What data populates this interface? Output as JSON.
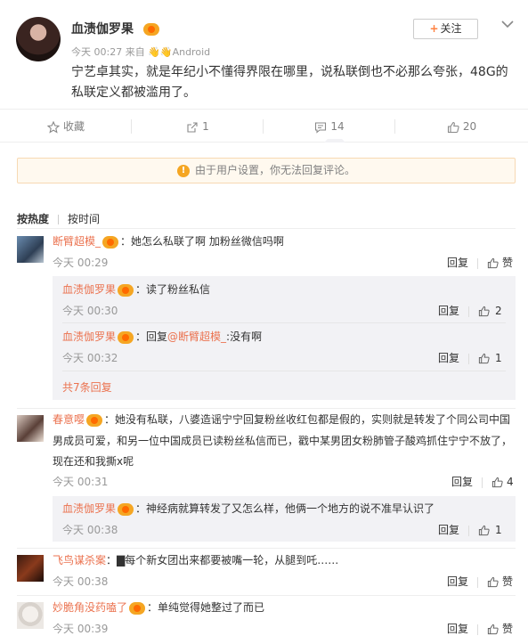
{
  "post": {
    "nickname": "血渍伽罗果",
    "meta": "今天 00:27 来自 👋👋Android",
    "content": "宁艺卓其实，就是年纪小不懂得界限在哪里，说私联倒也不必那么夸张，48G的私联定义都被滥用了。",
    "follow_label": "关注",
    "follow_plus": "+"
  },
  "actions": {
    "favorite_label": "收藏",
    "repost_count": "1",
    "comment_count": "14",
    "like_count": "20"
  },
  "notice": {
    "icon": "!",
    "text": "由于用户设置，你无法回复评论。"
  },
  "sort": {
    "hot": "按热度",
    "time": "按时间"
  },
  "comments": [
    {
      "user": "断臂超模_",
      "text": "：她怎么私联了啊  加粉丝微信吗啊",
      "time": "今天 00:29",
      "reply_label": "回复",
      "like_label": "赞",
      "replies": [
        {
          "user": "血渍伽罗果",
          "text": "：读了粉丝私信",
          "time": "今天 00:30",
          "reply_label": "回复",
          "likes": "2"
        },
        {
          "user": "血渍伽罗果",
          "text_pre": "：回复",
          "mention": "@断臂超模_",
          "text_post": ":没有啊",
          "time": "今天 00:32",
          "reply_label": "回复",
          "likes": "1"
        }
      ],
      "more": "共7条回复"
    },
    {
      "user": "春意嘤",
      "text_l1": "：她没有私联，八婆造谣宁宁回复粉丝收红包都是假的，实则就是转发了个同公司中国",
      "text_l2": "男成员可爱，和另一位中国成员已读粉丝私信而已，戳中某男团女粉肺管子酸鸡抓住宁宁不放了，",
      "text_l3": "现在还和我撕x呢",
      "time": "今天 00:31",
      "reply_label": "回复",
      "likes": "4",
      "replies": [
        {
          "user": "血渍伽罗果",
          "text": "：神经病就算转发了又怎么样，他俩一个地方的说不准早认识了",
          "time": "今天 00:38",
          "reply_label": "回复",
          "likes": "1"
        }
      ]
    },
    {
      "user": "飞鸟谋杀案",
      "text": "：▇每个新女团出来都要被嘴一轮，从腿到吒……",
      "time": "今天 00:38",
      "reply_label": "回复",
      "like_label": "赞"
    },
    {
      "user": "妙脆角没药嗑了",
      "text": "：单纯觉得她整过了而已",
      "time": "今天 00:39",
      "reply_label": "回复",
      "like_label": "赞"
    }
  ],
  "colors": {
    "username": "#eb7350",
    "meta": "#999999",
    "reply_bg": "#f2f2f5",
    "notice_bg": "#fff9ef",
    "accent": "#ff8140"
  }
}
